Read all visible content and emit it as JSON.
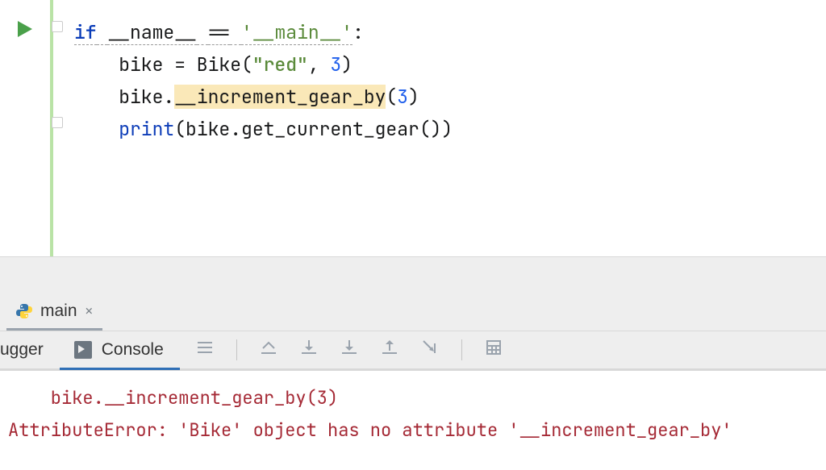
{
  "code": {
    "line1": {
      "if": "if",
      "name": "__name__",
      "eq": "==",
      "main": "'__main__'",
      "colon": ":"
    },
    "line2": {
      "text": "bike = Bike(",
      "string": "\"red\"",
      "comma": ", ",
      "num": "3",
      "close": ")"
    },
    "line3": {
      "obj": "bike.",
      "method": "__increment_gear_by",
      "open": "(",
      "num": "3",
      "close": ")"
    },
    "line4": {
      "print": "print",
      "open": "(",
      "arg": "bike.get_current_gear()",
      "close": ")"
    }
  },
  "run_tab": {
    "label": "main"
  },
  "debugger": {
    "debugger_label": "ugger",
    "console_label": "Console"
  },
  "console": {
    "line1": "    bike.__increment_gear_by(3)",
    "line2": "AttributeError: 'Bike' object has no attribute '__increment_gear_by'"
  }
}
